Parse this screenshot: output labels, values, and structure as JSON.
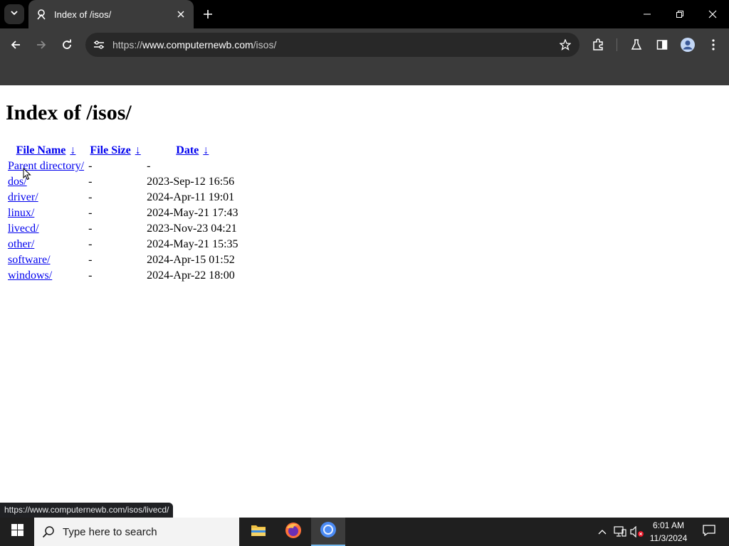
{
  "browser": {
    "tab_title": "Index of /isos/",
    "url_scheme": "https://",
    "url_host": "www.computernewb.com",
    "url_path": "/isos/"
  },
  "page": {
    "heading": "Index of /isos/",
    "columns": {
      "name": "File Name",
      "size": "File Size",
      "date": "Date",
      "sort_arrow": "↓"
    },
    "rows": [
      {
        "name": "Parent directory/",
        "size": "-",
        "date": "-"
      },
      {
        "name": "dos/",
        "size": "-",
        "date": "2023-Sep-12 16:56"
      },
      {
        "name": "driver/",
        "size": "-",
        "date": "2024-Apr-11 19:01"
      },
      {
        "name": "linux/",
        "size": "-",
        "date": "2024-May-21 17:43"
      },
      {
        "name": "livecd/",
        "size": "-",
        "date": "2023-Nov-23 04:21"
      },
      {
        "name": "other/",
        "size": "-",
        "date": "2024-May-21 15:35"
      },
      {
        "name": "software/",
        "size": "-",
        "date": "2024-Apr-15 01:52"
      },
      {
        "name": "windows/",
        "size": "-",
        "date": "2024-Apr-22 18:00"
      }
    ]
  },
  "status_url": "https://www.computernewb.com/isos/livecd/",
  "taskbar": {
    "search_placeholder": "Type here to search",
    "time": "6:01 AM",
    "date": "11/3/2024"
  },
  "colors": {
    "link": "#0000ee",
    "chrome_dark": "#3b3b3b",
    "taskbar": "#1f1f1f"
  }
}
